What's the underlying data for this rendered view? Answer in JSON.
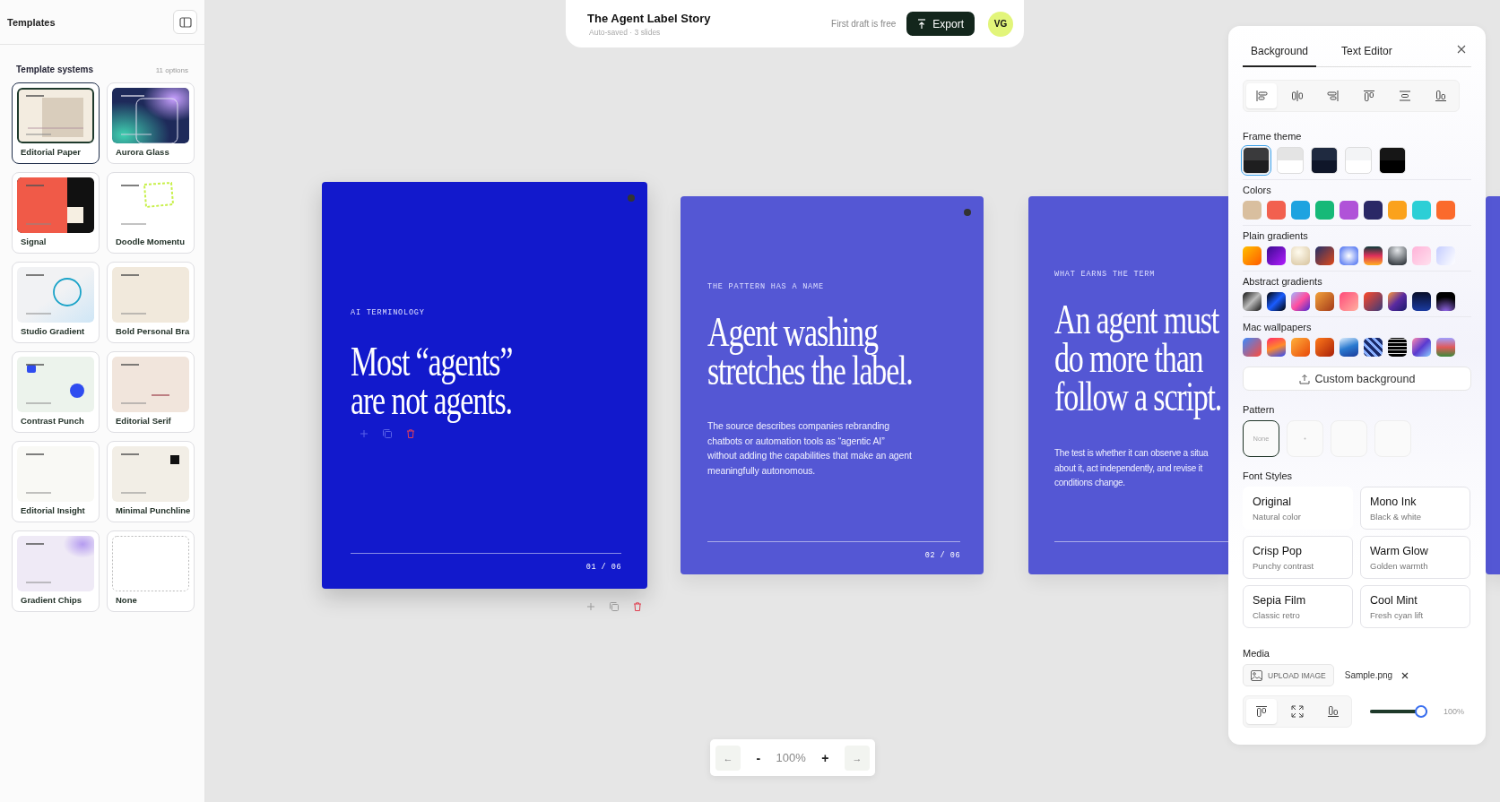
{
  "sidebar": {
    "title": "Templates",
    "section_title": "Template systems",
    "count": "11 options",
    "templates": [
      {
        "name": "Editorial Paper",
        "kind": "paper",
        "selected": true
      },
      {
        "name": "Aurora Glass",
        "kind": "aurora",
        "selected": false
      },
      {
        "name": "Signal",
        "kind": "signal",
        "selected": false
      },
      {
        "name": "Doodle Momentu",
        "kind": "doodle",
        "selected": false
      },
      {
        "name": "Studio Gradient",
        "kind": "studio",
        "selected": false
      },
      {
        "name": "Bold Personal Bra",
        "kind": "bold",
        "selected": false
      },
      {
        "name": "Contrast Punch",
        "kind": "contrast",
        "selected": false
      },
      {
        "name": "Editorial Serif",
        "kind": "serif",
        "selected": false
      },
      {
        "name": "Editorial Insight",
        "kind": "insight",
        "selected": false
      },
      {
        "name": "Minimal Punchline",
        "kind": "punchline",
        "selected": false
      },
      {
        "name": "Gradient Chips",
        "kind": "chips",
        "selected": false
      },
      {
        "name": "None",
        "kind": "none",
        "selected": false
      }
    ]
  },
  "topbar": {
    "title": "The Agent Label Story",
    "subtitle": "Auto-saved · 3 slides",
    "note": "First draft is free",
    "export": "Export",
    "avatar": "VG"
  },
  "slides": [
    {
      "selected": true,
      "label": "AI TERMINOLOGY",
      "heading": "Most “agents”\nare not agents.",
      "page": "01 / 06"
    },
    {
      "selected": false,
      "label": "THE PATTERN HAS A NAME",
      "heading": "Agent washing\nstretches the label.",
      "body": "The source describes companies rebranding\nchatbots or automation tools as “agentic AI”\nwithout adding the capabilities that make an agent\nmeaningfully autonomous.",
      "page": "02 / 06"
    },
    {
      "selected": false,
      "label": "WHAT EARNS THE TERM",
      "heading": "An agent must\ndo more than\nfollow a script.",
      "body": "The test is whether it can observe a situa\nabout it, act independently, and revise it\nconditions change."
    },
    {
      "selected": false
    }
  ],
  "panel": {
    "tabs": [
      {
        "label": "Background",
        "selected": true
      },
      {
        "label": "Text Editor",
        "selected": false
      }
    ],
    "alignments": [
      {
        "kind": "left",
        "selected": true
      },
      {
        "kind": "center",
        "selected": false
      },
      {
        "kind": "right",
        "selected": false
      },
      {
        "kind": "top",
        "selected": false
      },
      {
        "kind": "middle",
        "selected": false
      },
      {
        "kind": "bottom",
        "selected": false
      }
    ],
    "frame_theme": {
      "label": "Frame theme",
      "themes": [
        {
          "kind": "dark",
          "selected": true
        },
        {
          "kind": "light",
          "selected": false
        },
        {
          "kind": "navy",
          "selected": false
        },
        {
          "kind": "white",
          "selected": false
        },
        {
          "kind": "black",
          "selected": false
        }
      ]
    },
    "swatch_groups": [
      {
        "label": "Colors",
        "swatches": [
          {
            "color": "#d9bf9f"
          },
          {
            "color": "#f2604f"
          },
          {
            "color": "#1ea3e0"
          },
          {
            "color": "#17b978"
          },
          {
            "color": "#b052d8"
          },
          {
            "color": "#2a2866"
          },
          {
            "color": "#fba21c"
          },
          {
            "color": "#2ccfd6"
          },
          {
            "color": "#fb6a2c"
          }
        ]
      },
      {
        "label": "Plain gradients"
      },
      {
        "label": "Abstract gradients"
      },
      {
        "label": "Mac wallpapers"
      }
    ],
    "custom_button": "Custom background",
    "pattern": {
      "label": "Pattern",
      "options": [
        {
          "kind": "text",
          "label": "None",
          "selected": true
        },
        {
          "kind": "dot",
          "selected": false
        },
        {
          "kind": "blank",
          "selected": false
        },
        {
          "kind": "blank",
          "selected": false
        }
      ]
    },
    "font_styles": {
      "label": "Font Styles",
      "options": [
        {
          "name": "Original",
          "description": "Natural color",
          "selected": true
        },
        {
          "name": "Mono Ink",
          "description": "Black & white",
          "selected": false
        },
        {
          "name": "Crisp Pop",
          "description": "Punchy contrast",
          "selected": false
        },
        {
          "name": "Warm Glow",
          "description": "Golden warmth",
          "selected": false
        },
        {
          "name": "Sepia Film",
          "description": "Classic retro",
          "selected": false
        },
        {
          "name": "Cool Mint",
          "description": "Fresh cyan lift",
          "selected": false
        }
      ]
    },
    "media": {
      "label": "Media",
      "upload": "UPLOAD IMAGE",
      "file": "Sample.png",
      "positions": [
        {
          "kind": "top",
          "selected": true
        },
        {
          "kind": "fill",
          "selected": false
        },
        {
          "kind": "bottom",
          "selected": false
        }
      ],
      "scale": {
        "level": 1,
        "reading": "100%"
      }
    }
  },
  "zoom_bar": {
    "prev": "←",
    "minus": "-",
    "reading": "100%",
    "plus": "+",
    "next": "→"
  }
}
